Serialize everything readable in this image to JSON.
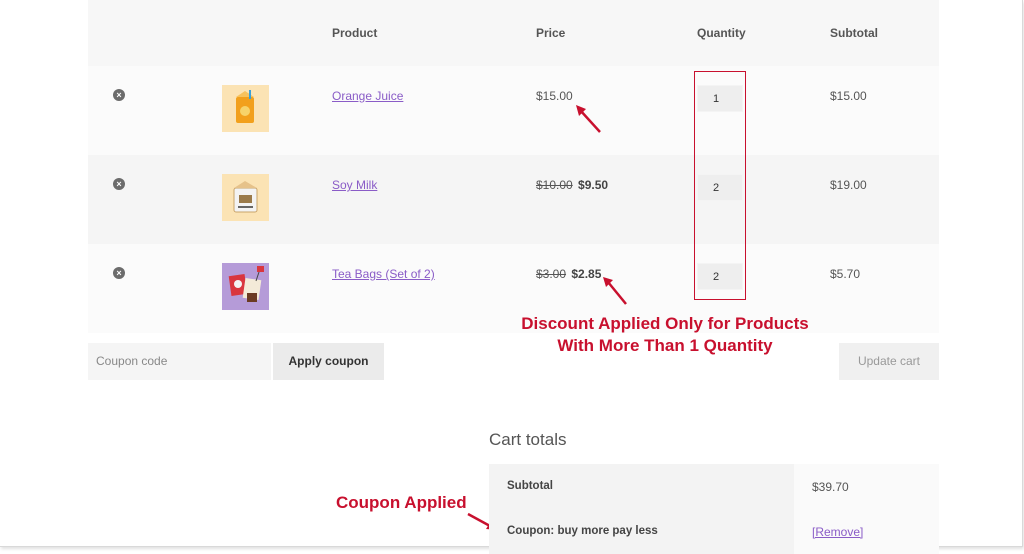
{
  "header": {
    "product": "Product",
    "price": "Price",
    "quantity": "Quantity",
    "subtotal": "Subtotal"
  },
  "items": [
    {
      "remove_glyph": "×",
      "icon": "orange-juice-carton",
      "name": "Orange Juice",
      "old_price": "",
      "price": "$15.00",
      "quantity": "1",
      "subtotal": "$15.00"
    },
    {
      "remove_glyph": "×",
      "icon": "soy-milk-carton",
      "name": "Soy Milk",
      "old_price": "$10.00",
      "price": "$9.50",
      "quantity": "2",
      "subtotal": "$19.00"
    },
    {
      "remove_glyph": "×",
      "icon": "tea-bags",
      "name": "Tea Bags (Set of 2)",
      "old_price": "$3.00",
      "price": "$2.85",
      "quantity": "2",
      "subtotal": "$5.70"
    }
  ],
  "actions": {
    "coupon_placeholder": "Coupon code",
    "apply_coupon": "Apply coupon",
    "update_cart": "Update cart"
  },
  "annotations": {
    "discount_line1": "Discount Applied Only for Products",
    "discount_line2": "With More Than 1 Quantity",
    "coupon_applied": "Coupon Applied",
    "color": "#c8102e"
  },
  "totals": {
    "title": "Cart totals",
    "subtotal_label": "Subtotal",
    "subtotal_value": "$39.70",
    "coupon_label": "Coupon: buy more pay less",
    "coupon_remove": "[Remove]"
  },
  "colors": {
    "link": "#8a5cc7",
    "accent": "#c8102e"
  }
}
